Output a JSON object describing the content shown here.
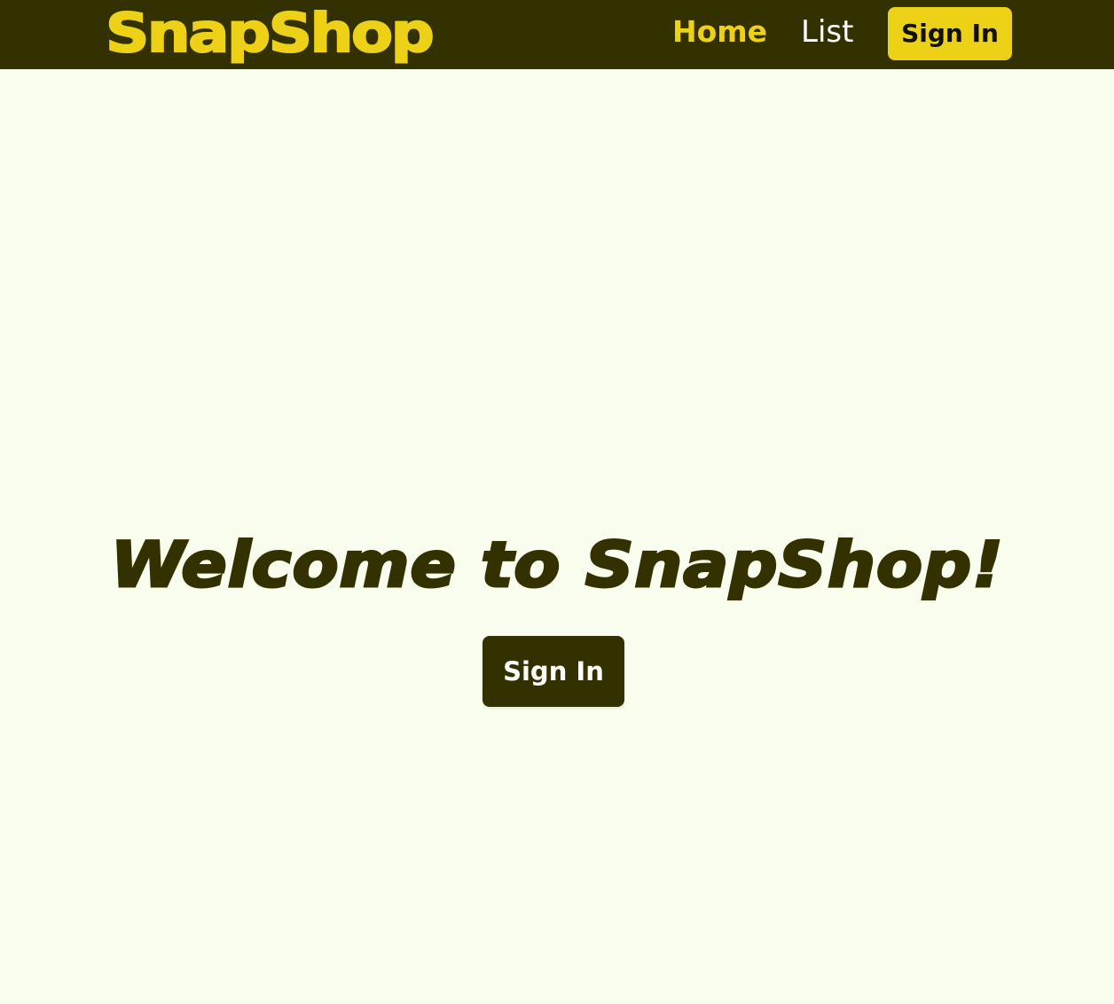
{
  "header": {
    "logo": "SnapShop",
    "nav": {
      "home": "Home",
      "list": "List"
    },
    "sign_in_label": "Sign In"
  },
  "hero": {
    "title": "Welcome to SnapShop!",
    "sign_in_label": "Sign In"
  },
  "colors": {
    "navbar_bg": "#333100",
    "accent_yellow": "#ecd117",
    "page_bg": "#f8fdee",
    "dark_text": "#333100"
  }
}
